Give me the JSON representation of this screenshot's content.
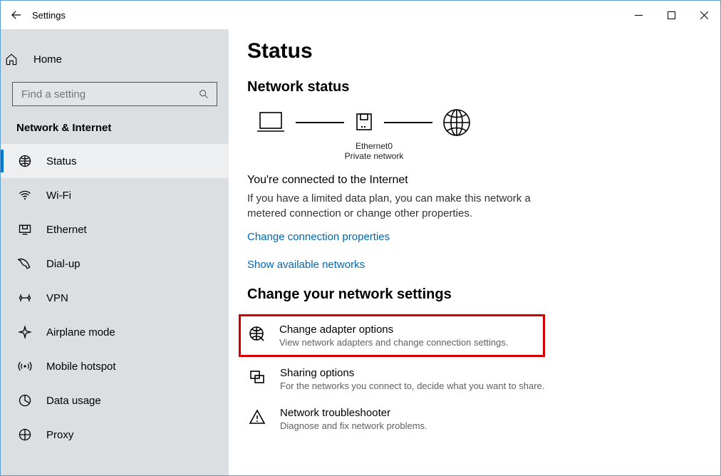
{
  "window": {
    "title": "Settings"
  },
  "sidebar": {
    "home": "Home",
    "search_placeholder": "Find a setting",
    "category": "Network & Internet",
    "items": [
      {
        "icon": "status-icon",
        "label": "Status",
        "selected": true
      },
      {
        "icon": "wifi-icon",
        "label": "Wi-Fi"
      },
      {
        "icon": "ethernet-icon",
        "label": "Ethernet"
      },
      {
        "icon": "dialup-icon",
        "label": "Dial-up"
      },
      {
        "icon": "vpn-icon",
        "label": "VPN"
      },
      {
        "icon": "airplane-icon",
        "label": "Airplane mode"
      },
      {
        "icon": "hotspot-icon",
        "label": "Mobile hotspot"
      },
      {
        "icon": "datausage-icon",
        "label": "Data usage"
      },
      {
        "icon": "proxy-icon",
        "label": "Proxy"
      }
    ]
  },
  "page": {
    "title": "Status",
    "network_status_heading": "Network status",
    "diagram": {
      "adapter_name": "Ethernet0",
      "network_type": "Private network"
    },
    "connected_headline": "You're connected to the Internet",
    "connected_body": "If you have a limited data plan, you can make this network a metered connection or change other properties.",
    "link_change_props": "Change connection properties",
    "link_show_networks": "Show available networks",
    "change_settings_heading": "Change your network settings",
    "settings": [
      {
        "icon": "adapter-icon",
        "title": "Change adapter options",
        "desc": "View network adapters and change connection settings.",
        "highlight": true
      },
      {
        "icon": "sharing-icon",
        "title": "Sharing options",
        "desc": "For the networks you connect to, decide what you want to share."
      },
      {
        "icon": "troubleshoot-icon",
        "title": "Network troubleshooter",
        "desc": "Diagnose and fix network problems."
      }
    ]
  }
}
